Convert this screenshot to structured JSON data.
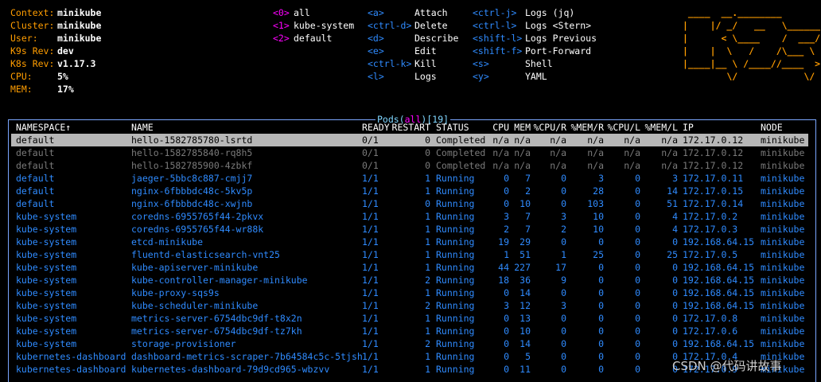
{
  "info": [
    {
      "label": "Context:",
      "value": "minikube"
    },
    {
      "label": "Cluster:",
      "value": "minikube"
    },
    {
      "label": "User:",
      "value": "minikube"
    },
    {
      "label": "K9s Rev:",
      "value": "dev"
    },
    {
      "label": "K8s Rev:",
      "value": "v1.17.3"
    },
    {
      "label": "CPU:",
      "value": "5%"
    },
    {
      "label": "MEM:",
      "value": "17%"
    }
  ],
  "namespaces": [
    {
      "key": "<0>",
      "name": "all"
    },
    {
      "key": "<1>",
      "name": "kube-system"
    },
    {
      "key": "<2>",
      "name": "default"
    }
  ],
  "hotkeys_col1": [
    {
      "key": "<a>",
      "action": "Attach"
    },
    {
      "key": "<ctrl-d>",
      "action": "Delete"
    },
    {
      "key": "<d>",
      "action": "Describe"
    },
    {
      "key": "<e>",
      "action": "Edit"
    },
    {
      "key": "<ctrl-k>",
      "action": "Kill"
    },
    {
      "key": "<l>",
      "action": "Logs"
    }
  ],
  "hotkeys_col2": [
    {
      "key": "<ctrl-j>",
      "action": "Logs (jq)"
    },
    {
      "key": "<ctrl-l>",
      "action": "Logs <Stern>"
    },
    {
      "key": "<shift-l>",
      "action": "Logs Previous"
    },
    {
      "key": "<shift-f>",
      "action": "Port-Forward"
    },
    {
      "key": "<s>",
      "action": "Shell"
    },
    {
      "key": "<y>",
      "action": "YAML"
    }
  ],
  "logo_lines": [
    " ____  __.________       ",
    "|    |/ _/   __   \\______",
    "|      < \\____    /  ___/",
    "|    |  \\   /    /\\___ \\ ",
    "|____|__ \\ /____//____  >",
    "        \\/            \\/ "
  ],
  "table": {
    "title_prefix": "Pods(",
    "title_ns": "all",
    "title_mid": ")[",
    "title_count": "19",
    "title_suffix": "]",
    "headers": {
      "namespace": "NAMESPACE↑",
      "name": "NAME",
      "ready": "READY",
      "restart": "RESTART",
      "status": "STATUS",
      "cpu": "CPU",
      "mem": "MEM",
      "cpur": "%CPU/R",
      "memr": "%MEM/R",
      "cpul": "%CPU/L",
      "meml": "%MEM/L",
      "ip": "IP",
      "node": "NODE"
    },
    "rows": [
      {
        "namespace": "default",
        "name": "hello-1582785780-lsrtd",
        "ready": "0/1",
        "restart": "0",
        "status": "Completed",
        "cpu": "n/a",
        "mem": "n/a",
        "cpur": "n/a",
        "memr": "n/a",
        "cpul": "n/a",
        "meml": "n/a",
        "ip": "172.17.0.12",
        "node": "minikube",
        "kind": "sel"
      },
      {
        "namespace": "default",
        "name": "hello-1582785840-rq8h5",
        "ready": "0/1",
        "restart": "0",
        "status": "Completed",
        "cpu": "n/a",
        "mem": "n/a",
        "cpur": "n/a",
        "memr": "n/a",
        "cpul": "n/a",
        "meml": "n/a",
        "ip": "172.17.0.12",
        "node": "minikube",
        "kind": "done"
      },
      {
        "namespace": "default",
        "name": "hello-1582785900-4zbkf",
        "ready": "0/1",
        "restart": "0",
        "status": "Completed",
        "cpu": "n/a",
        "mem": "n/a",
        "cpur": "n/a",
        "memr": "n/a",
        "cpul": "n/a",
        "meml": "n/a",
        "ip": "172.17.0.12",
        "node": "minikube",
        "kind": "done"
      },
      {
        "namespace": "default",
        "name": "jaeger-5bbc8c887-cmjj7",
        "ready": "1/1",
        "restart": "1",
        "status": "Running",
        "cpu": "0",
        "mem": "7",
        "cpur": "0",
        "memr": "3",
        "cpul": "0",
        "meml": "3",
        "ip": "172.17.0.11",
        "node": "minikube",
        "kind": "run"
      },
      {
        "namespace": "default",
        "name": "nginx-6fbbbdc48c-5kv5p",
        "ready": "1/1",
        "restart": "1",
        "status": "Running",
        "cpu": "0",
        "mem": "2",
        "cpur": "0",
        "memr": "28",
        "cpul": "0",
        "meml": "14",
        "ip": "172.17.0.15",
        "node": "minikube",
        "kind": "run"
      },
      {
        "namespace": "default",
        "name": "nginx-6fbbbdc48c-xwjnb",
        "ready": "1/1",
        "restart": "0",
        "status": "Running",
        "cpu": "0",
        "mem": "10",
        "cpur": "0",
        "memr": "103",
        "cpul": "0",
        "meml": "51",
        "ip": "172.17.0.14",
        "node": "minikube",
        "kind": "run"
      },
      {
        "namespace": "kube-system",
        "name": "coredns-6955765f44-2pkvx",
        "ready": "1/1",
        "restart": "1",
        "status": "Running",
        "cpu": "3",
        "mem": "7",
        "cpur": "3",
        "memr": "10",
        "cpul": "0",
        "meml": "4",
        "ip": "172.17.0.2",
        "node": "minikube",
        "kind": "run"
      },
      {
        "namespace": "kube-system",
        "name": "coredns-6955765f44-wr88k",
        "ready": "1/1",
        "restart": "1",
        "status": "Running",
        "cpu": "2",
        "mem": "7",
        "cpur": "2",
        "memr": "10",
        "cpul": "0",
        "meml": "4",
        "ip": "172.17.0.3",
        "node": "minikube",
        "kind": "run"
      },
      {
        "namespace": "kube-system",
        "name": "etcd-minikube",
        "ready": "1/1",
        "restart": "1",
        "status": "Running",
        "cpu": "19",
        "mem": "29",
        "cpur": "0",
        "memr": "0",
        "cpul": "0",
        "meml": "0",
        "ip": "192.168.64.15",
        "node": "minikube",
        "kind": "run"
      },
      {
        "namespace": "kube-system",
        "name": "fluentd-elasticsearch-vnt25",
        "ready": "1/1",
        "restart": "1",
        "status": "Running",
        "cpu": "1",
        "mem": "51",
        "cpur": "1",
        "memr": "25",
        "cpul": "0",
        "meml": "25",
        "ip": "172.17.0.5",
        "node": "minikube",
        "kind": "run"
      },
      {
        "namespace": "kube-system",
        "name": "kube-apiserver-minikube",
        "ready": "1/1",
        "restart": "1",
        "status": "Running",
        "cpu": "44",
        "mem": "227",
        "cpur": "17",
        "memr": "0",
        "cpul": "0",
        "meml": "0",
        "ip": "192.168.64.15",
        "node": "minikube",
        "kind": "run"
      },
      {
        "namespace": "kube-system",
        "name": "kube-controller-manager-minikube",
        "ready": "1/1",
        "restart": "2",
        "status": "Running",
        "cpu": "18",
        "mem": "36",
        "cpur": "9",
        "memr": "0",
        "cpul": "0",
        "meml": "0",
        "ip": "192.168.64.15",
        "node": "minikube",
        "kind": "run"
      },
      {
        "namespace": "kube-system",
        "name": "kube-proxy-sqs9s",
        "ready": "1/1",
        "restart": "1",
        "status": "Running",
        "cpu": "0",
        "mem": "14",
        "cpur": "0",
        "memr": "0",
        "cpul": "0",
        "meml": "0",
        "ip": "192.168.64.15",
        "node": "minikube",
        "kind": "run"
      },
      {
        "namespace": "kube-system",
        "name": "kube-scheduler-minikube",
        "ready": "1/1",
        "restart": "2",
        "status": "Running",
        "cpu": "3",
        "mem": "12",
        "cpur": "3",
        "memr": "0",
        "cpul": "0",
        "meml": "0",
        "ip": "192.168.64.15",
        "node": "minikube",
        "kind": "run"
      },
      {
        "namespace": "kube-system",
        "name": "metrics-server-6754dbc9df-t8x2n",
        "ready": "1/1",
        "restart": "1",
        "status": "Running",
        "cpu": "0",
        "mem": "13",
        "cpur": "0",
        "memr": "0",
        "cpul": "0",
        "meml": "0",
        "ip": "172.17.0.8",
        "node": "minikube",
        "kind": "run"
      },
      {
        "namespace": "kube-system",
        "name": "metrics-server-6754dbc9df-tz7kh",
        "ready": "1/1",
        "restart": "1",
        "status": "Running",
        "cpu": "0",
        "mem": "10",
        "cpur": "0",
        "memr": "0",
        "cpul": "0",
        "meml": "0",
        "ip": "172.17.0.6",
        "node": "minikube",
        "kind": "run"
      },
      {
        "namespace": "kube-system",
        "name": "storage-provisioner",
        "ready": "1/1",
        "restart": "2",
        "status": "Running",
        "cpu": "0",
        "mem": "14",
        "cpur": "0",
        "memr": "0",
        "cpul": "0",
        "meml": "0",
        "ip": "192.168.64.15",
        "node": "minikube",
        "kind": "run"
      },
      {
        "namespace": "kubernetes-dashboard",
        "name": "dashboard-metrics-scraper-7b64584c5c-5tjsh",
        "ready": "1/1",
        "restart": "1",
        "status": "Running",
        "cpu": "0",
        "mem": "5",
        "cpur": "0",
        "memr": "0",
        "cpul": "0",
        "meml": "0",
        "ip": "172.17.0.4",
        "node": "minikube",
        "kind": "run"
      },
      {
        "namespace": "kubernetes-dashboard",
        "name": "kubernetes-dashboard-79d9cd965-wbzvv",
        "ready": "1/1",
        "restart": "1",
        "status": "Running",
        "cpu": "0",
        "mem": "11",
        "cpur": "0",
        "memr": "0",
        "cpul": "0",
        "meml": "0",
        "ip": "172.17.0.9",
        "node": "minikube",
        "kind": "run"
      }
    ]
  },
  "watermark": "CSDN @代码讲故事"
}
